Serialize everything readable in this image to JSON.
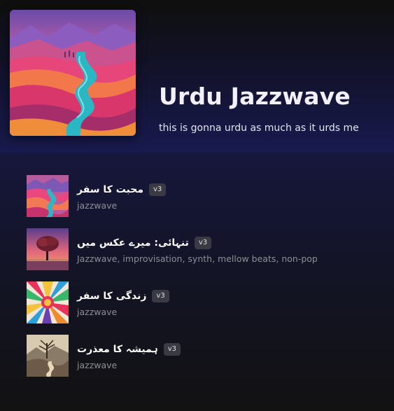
{
  "playlist": {
    "title": "Urdu Jazzwave",
    "description": "this is gonna urdu as much as it urds me",
    "cover_icon": "landscape-valley-river-art"
  },
  "tracks": [
    {
      "title": "محبت کا سفر",
      "version": "v3",
      "tags": "jazzwave",
      "thumb_icon": "pink-valley-river-art"
    },
    {
      "title": "تنہائی: میرے عکس میں",
      "version": "v3",
      "tags": "Jazzwave, improvisation, synth, mellow beats, non-pop",
      "thumb_icon": "lone-tree-sunset-art"
    },
    {
      "title": "زندگی کا سفر",
      "version": "v3",
      "tags": "jazzwave",
      "thumb_icon": "color-explosion-art"
    },
    {
      "title": "ہمیشہ کا معذرت",
      "version": "v3",
      "tags": "jazzwave",
      "thumb_icon": "barren-tree-path-art"
    }
  ],
  "colors": {
    "background": "#121212",
    "header_gradient_end": "#181a4e",
    "badge_bg": "#3a3a44",
    "tag_text": "#8e8e96"
  }
}
